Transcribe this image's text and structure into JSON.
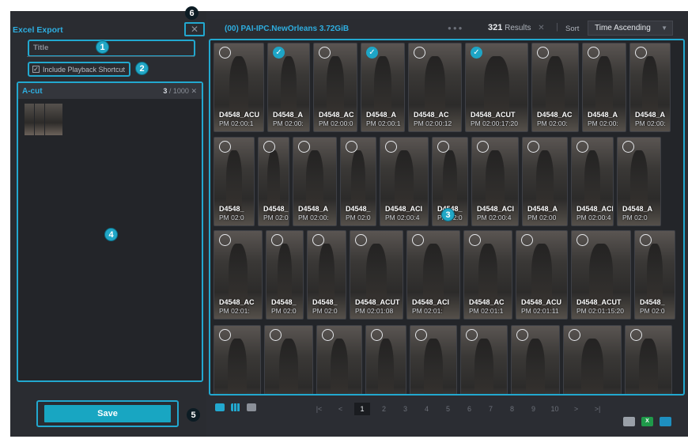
{
  "left_panel": {
    "title": "Excel Export",
    "close": "✕",
    "title_placeholder": "Title",
    "include_playback_label": "Include Playback Shortcut",
    "include_playback_checked": true,
    "acut": {
      "title": "A-cut",
      "count": "3",
      "total": "/ 1000",
      "clear": "✕"
    },
    "save_label": "Save"
  },
  "header": {
    "source": "(00) PAI-IPC.NewOrleans 3.72GiB",
    "dots": "●●●",
    "results_count": "321",
    "results_label": "Results",
    "results_clear": "✕",
    "separator": "|",
    "sort_label": "Sort",
    "sort_value": "Time Ascending"
  },
  "badges": [
    "1",
    "2",
    "3",
    "4",
    "5",
    "6"
  ],
  "rows": [
    [
      {
        "label": "D4548_ACU",
        "time": "PM 02:00:1",
        "selected": false
      },
      {
        "label": "D4548_A",
        "time": "PM 02:00:",
        "selected": true
      },
      {
        "label": "D4548_AC",
        "time": "PM 02:00:0",
        "selected": false
      },
      {
        "label": "D4548_A",
        "time": "PM 02:00:1",
        "selected": true
      },
      {
        "label": "D4548_AC",
        "time": "PM 02:00:12",
        "selected": false
      },
      {
        "label": "D4548_ACUT",
        "time": "PM 02:00:17:20",
        "selected": true
      },
      {
        "label": "D4548_AC",
        "time": "PM 02:00:",
        "selected": false
      },
      {
        "label": "D4548_A",
        "time": "PM 02:00:",
        "selected": false
      },
      {
        "label": "D4548_A",
        "time": "PM 02:00:",
        "selected": false
      }
    ],
    [
      {
        "label": "D4548_",
        "time": "PM 02:0",
        "selected": false
      },
      {
        "label": "D4548_",
        "time": "PM 02:0",
        "selected": false
      },
      {
        "label": "D4548_A",
        "time": "PM 02:00:",
        "selected": false
      },
      {
        "label": "D4548_",
        "time": "PM 02:0",
        "selected": false
      },
      {
        "label": "D4548_ACI",
        "time": "PM 02:00:4",
        "selected": false
      },
      {
        "label": "D4548_",
        "time": "PM 02:0",
        "selected": false
      },
      {
        "label": "D4548_ACI",
        "time": "PM 02:00:4",
        "selected": false
      },
      {
        "label": "D4548_A",
        "time": "PM 02:00",
        "selected": false
      },
      {
        "label": "D4548_ACI",
        "time": "PM 02:00:4",
        "selected": false
      },
      {
        "label": "D4548_A",
        "time": "PM 02:0",
        "selected": false
      }
    ],
    [
      {
        "label": "D4548_AC",
        "time": "PM 02:01:",
        "selected": false
      },
      {
        "label": "D4548_",
        "time": "PM 02:0",
        "selected": false
      },
      {
        "label": "D4548_",
        "time": "PM 02:0",
        "selected": false
      },
      {
        "label": "D4548_ACUT",
        "time": "PM 02:01:08",
        "selected": false
      },
      {
        "label": "D4548_ACI",
        "time": "PM 02:01:",
        "selected": false
      },
      {
        "label": "D4548_AC",
        "time": "PM 02:01:1",
        "selected": false
      },
      {
        "label": "D4548_ACU",
        "time": "PM 02:01:11",
        "selected": false
      },
      {
        "label": "D4548_ACUT",
        "time": "PM 02:01:15:20",
        "selected": false
      },
      {
        "label": "D4548_",
        "time": "PM 02:0",
        "selected": false
      }
    ],
    [
      {
        "label": "",
        "time": "",
        "selected": false
      },
      {
        "label": "",
        "time": "",
        "selected": false
      },
      {
        "label": "",
        "time": "",
        "selected": false
      },
      {
        "label": "",
        "time": "",
        "selected": false
      },
      {
        "label": "",
        "time": "",
        "selected": false
      },
      {
        "label": "",
        "time": "",
        "selected": false
      },
      {
        "label": "",
        "time": "",
        "selected": false
      },
      {
        "label": "",
        "time": "",
        "selected": false
      },
      {
        "label": "",
        "time": "",
        "selected": false
      }
    ]
  ],
  "pager": {
    "first": "|<",
    "prev": "<",
    "pages": [
      "1",
      "2",
      "3",
      "4",
      "5",
      "6",
      "7",
      "8",
      "9",
      "10"
    ],
    "current": "1",
    "next": ">",
    "last": ">|"
  },
  "footer_icons": [
    "image-export-icon",
    "excel-icon",
    "screen-capture-icon"
  ],
  "colors": {
    "accent": "#22a8cf",
    "panel": "#2a2c31",
    "save": "#18a6c2"
  }
}
